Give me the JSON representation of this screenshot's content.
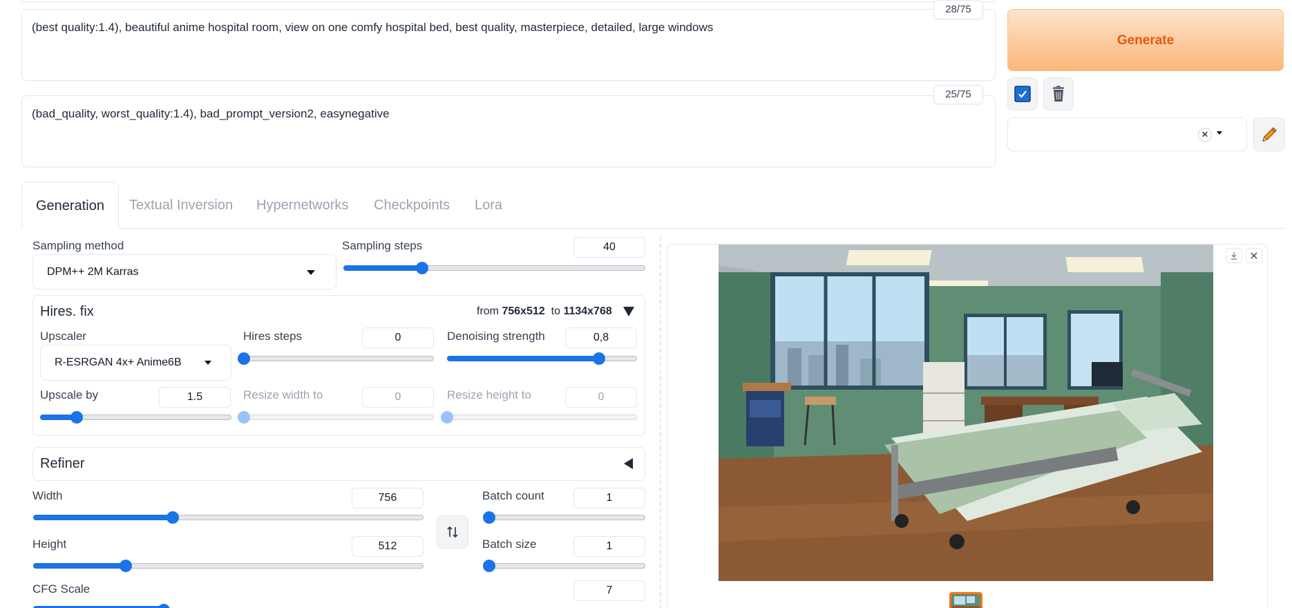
{
  "prompt": {
    "positive_text": "(best quality:1.4), beautiful anime hospital room, view on one  comfy hospital bed, best quality, masterpiece, detailed, large windows",
    "positive_tokens": "28/75",
    "negative_text": "(bad_quality, worst_quality:1.4), bad_prompt_version2, easynegative",
    "negative_tokens": "25/75"
  },
  "actions": {
    "generate_label": "Generate",
    "styles_value": "",
    "icons": [
      "checkbox-icon",
      "trash-icon",
      "close-icon",
      "chevron-down-icon",
      "pencil-icon"
    ]
  },
  "tabs": [
    {
      "label": "Generation",
      "active": true
    },
    {
      "label": "Textual Inversion",
      "active": false
    },
    {
      "label": "Hypernetworks",
      "active": false
    },
    {
      "label": "Checkpoints",
      "active": false
    },
    {
      "label": "Lora",
      "active": false
    }
  ],
  "sampling": {
    "method_label": "Sampling method",
    "method_value": "DPM++ 2M Karras",
    "steps_label": "Sampling steps",
    "steps_value": "40",
    "steps_fraction": 0.26
  },
  "hires": {
    "title": "Hires. fix",
    "from_prefix": "from ",
    "from_value": "756x512",
    "to_prefix": "to ",
    "to_value": "1134x768",
    "upscaler_label": "Upscaler",
    "upscaler_value": "R-ESRGAN 4x+ Anime6B",
    "hires_steps_label": "Hires steps",
    "hires_steps_value": "0",
    "hires_steps_fraction": 0.0,
    "denoise_label": "Denoising strength",
    "denoise_value": "0,8",
    "denoise_fraction": 0.8,
    "upscale_by_label": "Upscale by",
    "upscale_by_value": "1.5",
    "upscale_by_fraction": 0.19,
    "resize_w_label": "Resize width to",
    "resize_w_value": "0",
    "resize_h_label": "Resize height to",
    "resize_h_value": "0"
  },
  "refiner": {
    "title": "Refiner"
  },
  "dimensions": {
    "width_label": "Width",
    "width_value": "756",
    "width_fraction": 0.357,
    "height_label": "Height",
    "height_value": "512",
    "height_fraction": 0.237,
    "batch_count_label": "Batch count",
    "batch_count_value": "1",
    "batch_count_fraction": 0.0,
    "batch_size_label": "Batch size",
    "batch_size_value": "1",
    "batch_size_fraction": 0.0,
    "cfg_label": "CFG Scale",
    "cfg_value": "7"
  },
  "gallery": {
    "image_alt": "anime hospital room"
  }
}
